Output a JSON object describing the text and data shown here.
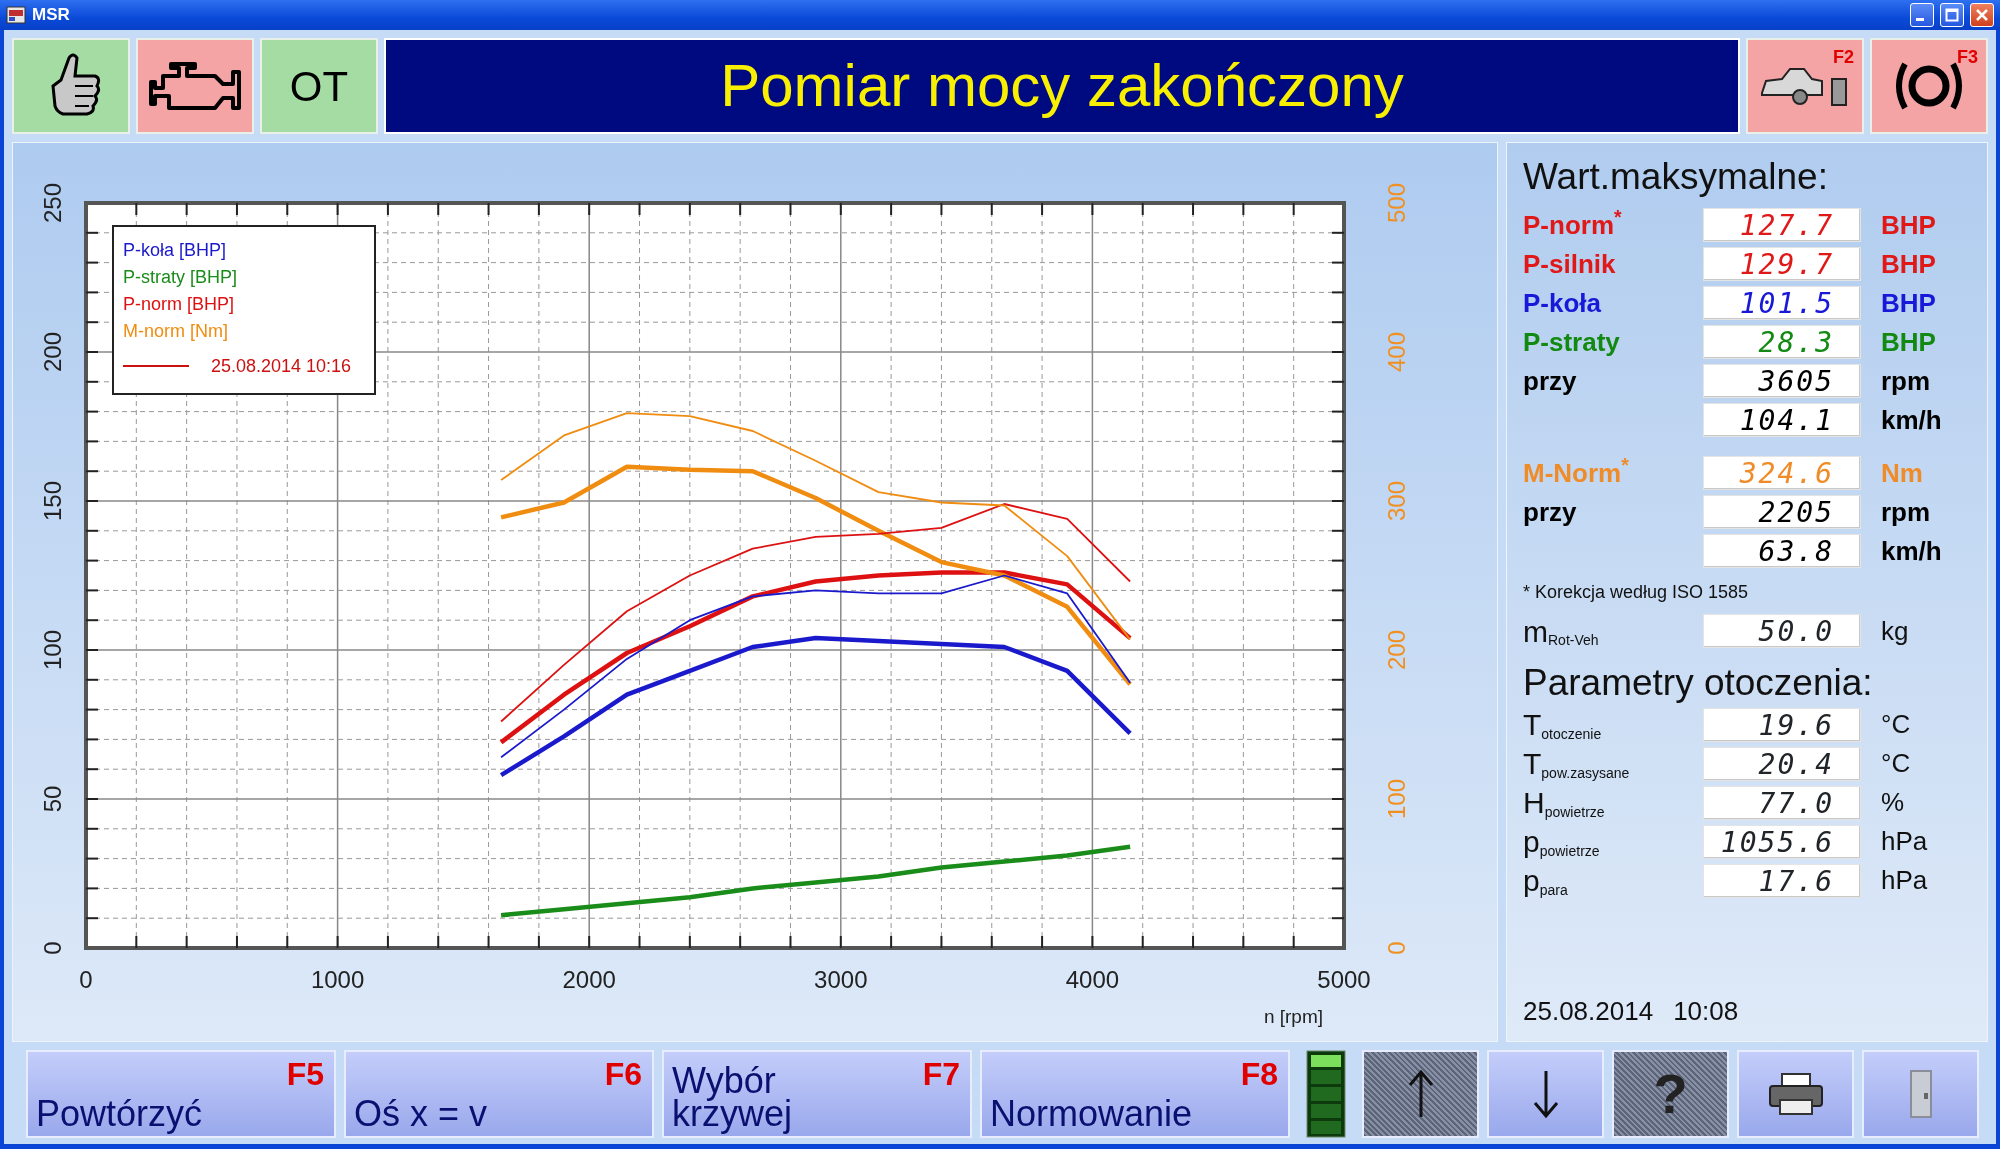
{
  "window": {
    "title": "MSR"
  },
  "indicators": [
    {
      "kind": "thumb",
      "color": "#a4dca4"
    },
    {
      "kind": "engine",
      "color": "#f4a4a4"
    },
    {
      "kind": "text",
      "label": "OT",
      "color": "#a4dca4"
    }
  ],
  "banner": "Pomiar mocy zakończony",
  "top_buttons": [
    {
      "kind": "car",
      "key": "F2"
    },
    {
      "kind": "brake",
      "key": "F3"
    }
  ],
  "chart": {
    "chart_data": {
      "type": "line",
      "grid": true,
      "xlabel": "n [rpm]",
      "x": [
        1650,
        1900,
        2150,
        2400,
        2650,
        2900,
        3150,
        3400,
        3650,
        3900,
        4150
      ],
      "xlim": [
        0,
        5000
      ],
      "ylim": [
        0,
        250
      ],
      "xticks": [
        0,
        1000,
        2000,
        3000,
        4000,
        5000
      ],
      "yticks": [
        0,
        50,
        100,
        150,
        200,
        250
      ],
      "y2lim": [
        0,
        500
      ],
      "y2ticks": [
        0,
        100,
        200,
        300,
        400,
        500
      ],
      "series": [
        {
          "name": "P-koła [BHP]",
          "color": "#1a1acc",
          "values": [
            58,
            71,
            85,
            93,
            101,
            104,
            103,
            102,
            101,
            93,
            72
          ]
        },
        {
          "name": "P-straty [BHP]",
          "color": "#1a8c1a",
          "values": [
            11,
            13,
            15,
            17,
            20,
            22,
            24,
            27,
            29,
            31,
            34
          ]
        },
        {
          "name": "P-norm [BHP]",
          "color": "#dd1111",
          "values": [
            69,
            85,
            99,
            108,
            118,
            123,
            125,
            126,
            126,
            122,
            104
          ]
        },
        {
          "name": "M-norm [Nm]",
          "axis": "y2",
          "color": "#f08c10",
          "values": [
            289,
            299,
            323,
            321,
            320,
            302,
            280,
            259,
            250,
            229,
            177
          ]
        },
        {
          "color": "#1a1acc",
          "values": [
            64,
            80,
            97,
            110,
            118,
            120,
            119,
            119,
            125,
            119,
            89
          ]
        },
        {
          "color": "#dd1111",
          "values": [
            76,
            95,
            113,
            125,
            134,
            138,
            139,
            141,
            149,
            144,
            123
          ]
        },
        {
          "axis": "y2",
          "color": "#f08c10",
          "values": [
            314,
            344,
            359,
            357,
            347,
            327,
            306,
            299,
            297,
            263,
            207
          ]
        }
      ]
    },
    "reference": {
      "label": "25.08.2014 10:16",
      "color": "#cc1111"
    }
  },
  "max_values": {
    "title": "Wart.maksymalne:",
    "groups": [
      [
        {
          "label": "P-norm$^{*}$",
          "value": "127.7",
          "unit": "BHP",
          "color": "#e01818"
        },
        {
          "label": "P-silnik",
          "value": "129.7",
          "unit": "BHP",
          "color": "#e01818"
        },
        {
          "label": "P-koła",
          "value": "101.5",
          "unit": "BHP",
          "color": "#1818d8"
        },
        {
          "label": "P-straty",
          "value": "28.3",
          "unit": "BHP",
          "color": "#128a12"
        },
        {
          "label": "przy",
          "value": "3605",
          "unit": "rpm",
          "color": "#000000"
        },
        {
          "value": "104.1",
          "unit": "km/h",
          "color": "#000000"
        }
      ],
      [
        {
          "label": "M-Norm$^{*}$",
          "value": "324.6",
          "unit": "Nm",
          "color": "#f08c28"
        },
        {
          "label": "przy",
          "value": "2205",
          "unit": "rpm",
          "color": "#000000"
        },
        {
          "value": "63.8",
          "unit": "km/h",
          "color": "#000000"
        }
      ]
    ]
  },
  "note": "* Korekcja według ISO 1585",
  "mass": {
    "label": "m$_{Rot-Veh}$",
    "value": "50.0",
    "unit": "kg"
  },
  "ambient": {
    "title": "Parametry otoczenia:",
    "rows": [
      {
        "label": "T$_{otoczenie}$",
        "value": "19.6",
        "unit": "°C"
      },
      {
        "label": "T$_{pow.zasysane}$",
        "value": "20.4",
        "unit": "°C"
      },
      {
        "label": "H$_{powietrze}$",
        "value": "77.0",
        "unit": "%"
      },
      {
        "label": "p$_{powietrze}$",
        "value": "1055.6",
        "unit": "hPa"
      },
      {
        "label": "p$_{para}$",
        "value": "17.6",
        "unit": "hPa"
      }
    ]
  },
  "date": "25.08.2014",
  "time": "10:08",
  "function_buttons": [
    {
      "label": "Powtórzyć",
      "key": "F5"
    },
    {
      "label": "Oś x = v",
      "key": "F6"
    },
    {
      "label": "Wybór krzywej",
      "key": "F7"
    },
    {
      "label": "Normowanie",
      "key": "F8"
    }
  ],
  "tool_buttons": [
    {
      "kind": "up",
      "disabled": true
    },
    {
      "kind": "down",
      "disabled": false
    },
    {
      "kind": "help",
      "glyph": "?",
      "disabled": true
    },
    {
      "kind": "print",
      "disabled": false
    },
    {
      "kind": "exit",
      "disabled": false
    }
  ]
}
